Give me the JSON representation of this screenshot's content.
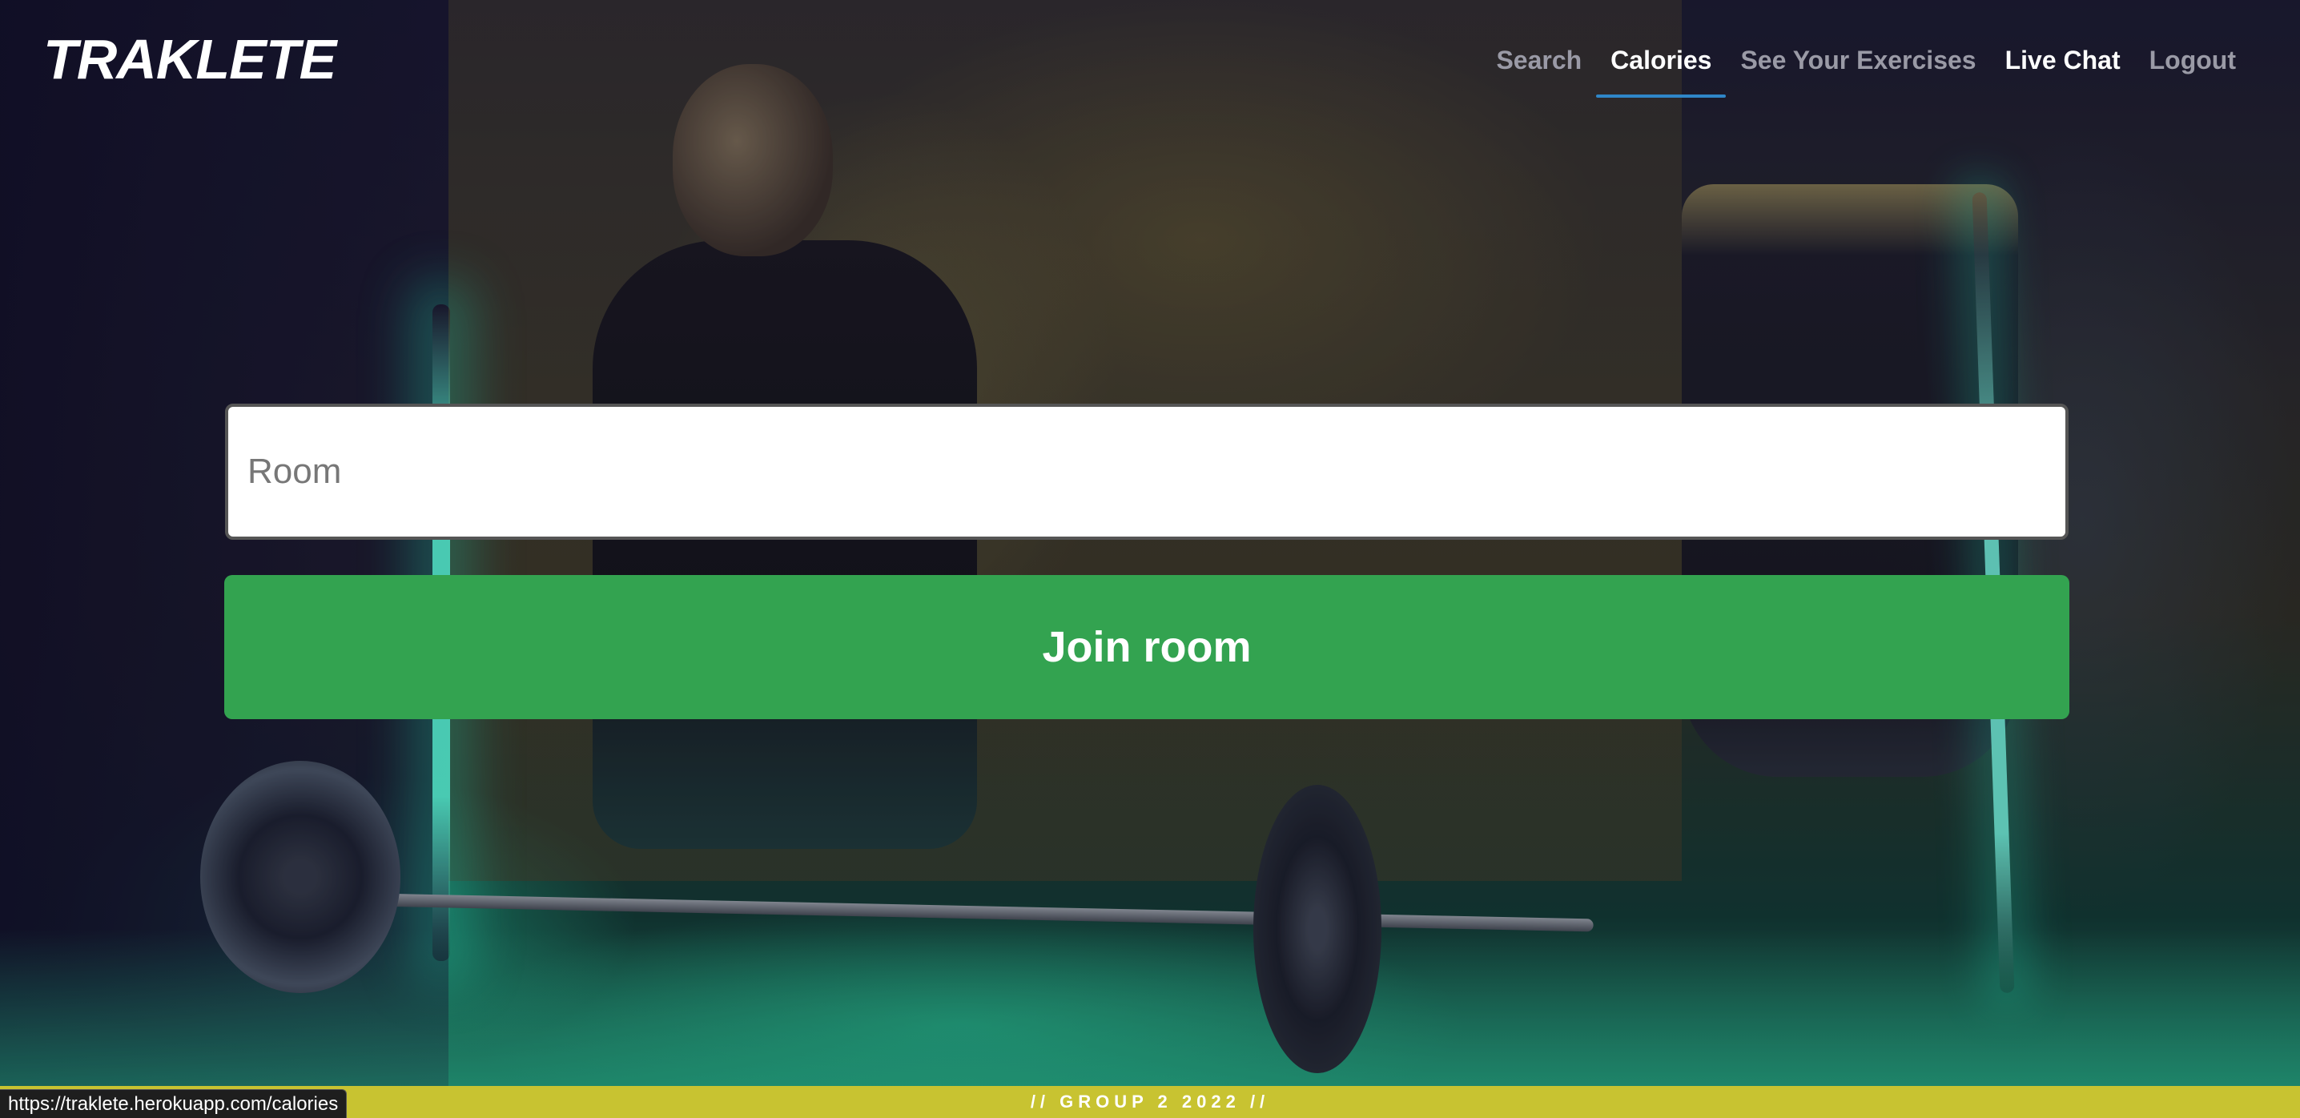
{
  "brand": {
    "name": "TRAKLETE"
  },
  "nav": {
    "items": [
      {
        "label": "Search",
        "active": false
      },
      {
        "label": "Calories",
        "active": true
      },
      {
        "label": "See Your Exercises",
        "active": false
      },
      {
        "label": "Live Chat",
        "active": false
      },
      {
        "label": "Logout",
        "active": false
      }
    ]
  },
  "form": {
    "room_placeholder": "Room",
    "room_value": "",
    "join_label": "Join room",
    "join_color": "#33a350"
  },
  "footer": {
    "text": "// GROUP 2 2022 //",
    "color": "#c8c331"
  },
  "status_bar": {
    "url": "https://traklete.herokuapp.com/calories"
  },
  "colors": {
    "active_underline": "#2f86c8"
  }
}
